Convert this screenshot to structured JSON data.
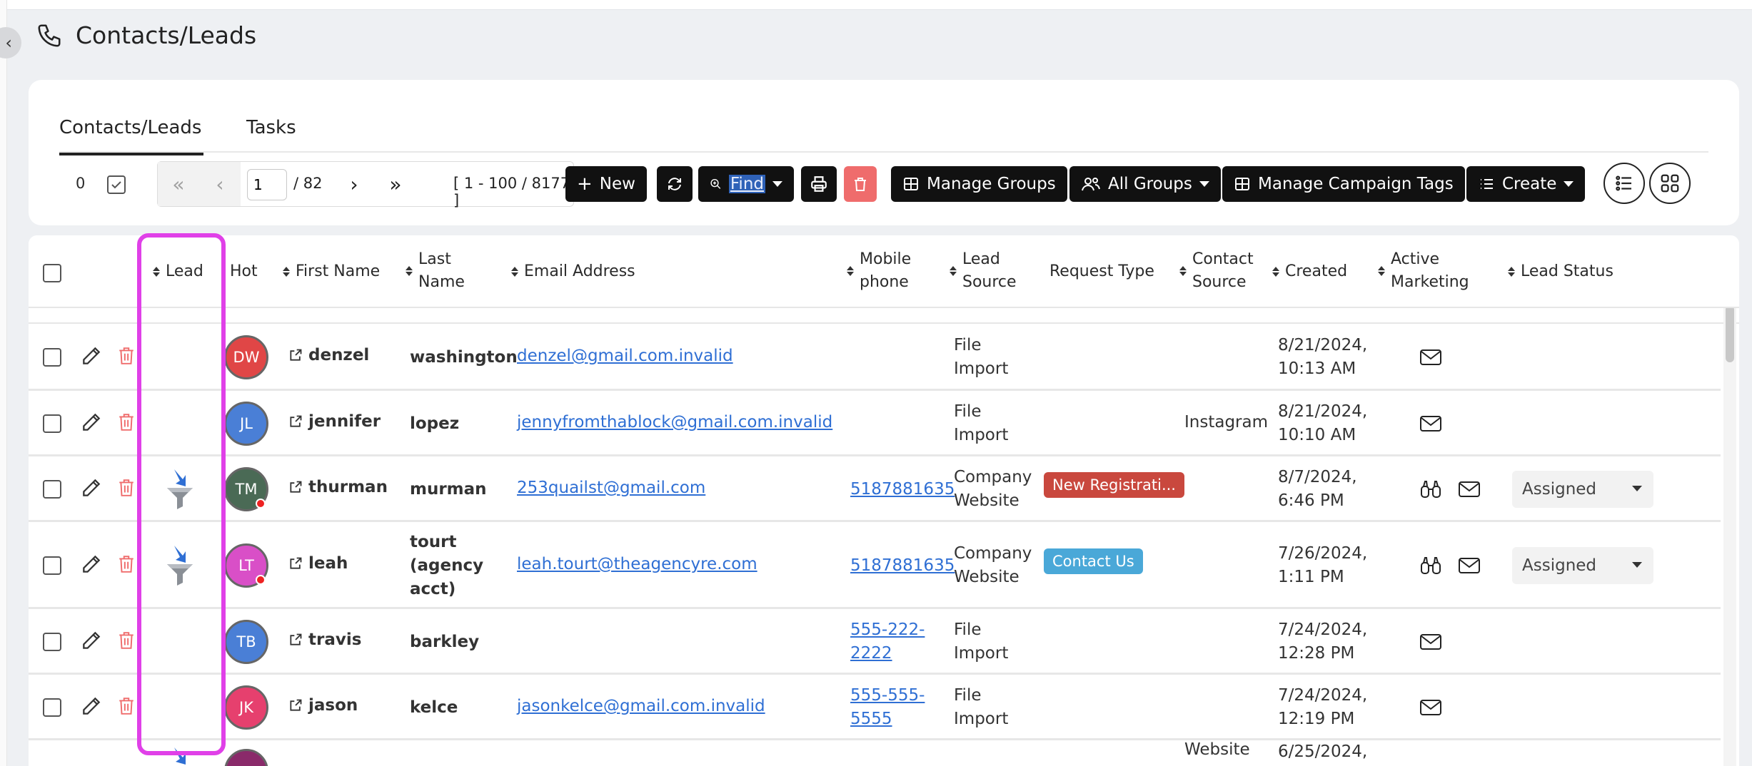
{
  "page": {
    "title": "Contacts/Leads"
  },
  "tabs": [
    {
      "label": "Contacts/Leads",
      "active": true
    },
    {
      "label": "Tasks",
      "active": false
    }
  ],
  "toolbar": {
    "selected_count": "0",
    "page_current": "1",
    "page_total": "/ 82",
    "range": "[ 1 - 100 / 8177 ]",
    "new_label": "New",
    "find_label": "Find",
    "manage_groups_label": "Manage Groups",
    "all_groups_label": "All Groups",
    "manage_campaign_tags_label": "Manage Campaign Tags",
    "create_label": "Create"
  },
  "columns": {
    "lead": "Lead",
    "hot": "Hot",
    "first_name": "First Name",
    "last_name_1": "Last",
    "last_name_2": "Name",
    "email": "Email Address",
    "mobile_1": "Mobile",
    "mobile_2": "phone",
    "lead_source_1": "Lead",
    "lead_source_2": "Source",
    "request_type": "Request Type",
    "contact_source_1": "Contact",
    "contact_source_2": "Source",
    "created": "Created",
    "active_marketing_1": "Active",
    "active_marketing_2": "Marketing",
    "lead_status": "Lead Status"
  },
  "rows": [
    {
      "initials": "DW",
      "avatar_color": "#e04646",
      "hot": false,
      "lead_icon": false,
      "first_name": "denzel",
      "last_name": [
        "washington"
      ],
      "email": "denzel@gmail.com.invalid",
      "phone": [],
      "lead_source": [
        "File",
        "Import"
      ],
      "request_type": null,
      "contact_source": "",
      "created": [
        "8/21/2024,",
        "10:13 AM"
      ],
      "binoculars": false,
      "status": null
    },
    {
      "initials": "JL",
      "avatar_color": "#4a7fd6",
      "hot": false,
      "lead_icon": false,
      "first_name": "jennifer",
      "last_name": [
        "lopez"
      ],
      "email": "jennyfromthablock@gmail.com.invalid",
      "phone": [],
      "lead_source": [
        "File",
        "Import"
      ],
      "request_type": null,
      "contact_source": "Instagram",
      "created": [
        "8/21/2024,",
        "10:10 AM"
      ],
      "binoculars": false,
      "status": null
    },
    {
      "initials": "TM",
      "avatar_color": "#4a6a55",
      "hot": true,
      "lead_icon": true,
      "first_name": "thurman",
      "last_name": [
        "murman"
      ],
      "email": "253quailst@gmail.com",
      "phone": [
        "5187881635"
      ],
      "lead_source": [
        "Company",
        "Website"
      ],
      "request_type": {
        "label": "New Registrati...",
        "color": "#c9483e"
      },
      "contact_source": "",
      "created": [
        "8/7/2024,",
        "6:46 PM"
      ],
      "binoculars": true,
      "status": "Assigned"
    },
    {
      "initials": "LT",
      "avatar_color": "#d94fc7",
      "hot": true,
      "lead_icon": true,
      "first_name": "leah",
      "last_name": [
        "tourt",
        "(agency",
        "acct)"
      ],
      "email": "leah.tourt@theagencyre.com",
      "phone": [
        "5187881635"
      ],
      "lead_source": [
        "Company",
        "Website"
      ],
      "request_type": {
        "label": "Contact Us",
        "color": "#4aa8d8"
      },
      "contact_source": "",
      "created": [
        "7/26/2024,",
        "1:11 PM"
      ],
      "binoculars": true,
      "status": "Assigned"
    },
    {
      "initials": "TB",
      "avatar_color": "#4a7fd6",
      "hot": false,
      "lead_icon": false,
      "first_name": "travis",
      "last_name": [
        "barkley"
      ],
      "email": "",
      "phone": [
        "555-222-",
        "2222"
      ],
      "lead_source": [
        "File",
        "Import"
      ],
      "request_type": null,
      "contact_source": "",
      "created": [
        "7/24/2024,",
        "12:28 PM"
      ],
      "binoculars": false,
      "status": null
    },
    {
      "initials": "JK",
      "avatar_color": "#e6406e",
      "hot": false,
      "lead_icon": false,
      "first_name": "jason",
      "last_name": [
        "kelce"
      ],
      "email": "jasonkelce@gmail.com.invalid",
      "phone": [
        "555-555-",
        "5555"
      ],
      "lead_source": [
        "File",
        "Import"
      ],
      "request_type": null,
      "contact_source": "",
      "created": [
        "7/24/2024,",
        "12:19 PM"
      ],
      "binoculars": false,
      "status": null
    }
  ],
  "bottom_partial": {
    "contact_source": "Website",
    "created": "6/25/2024,"
  },
  "colors": {
    "highlight": "#e040e8",
    "link": "#2f6fd4",
    "delete": "#ef6c6c"
  }
}
